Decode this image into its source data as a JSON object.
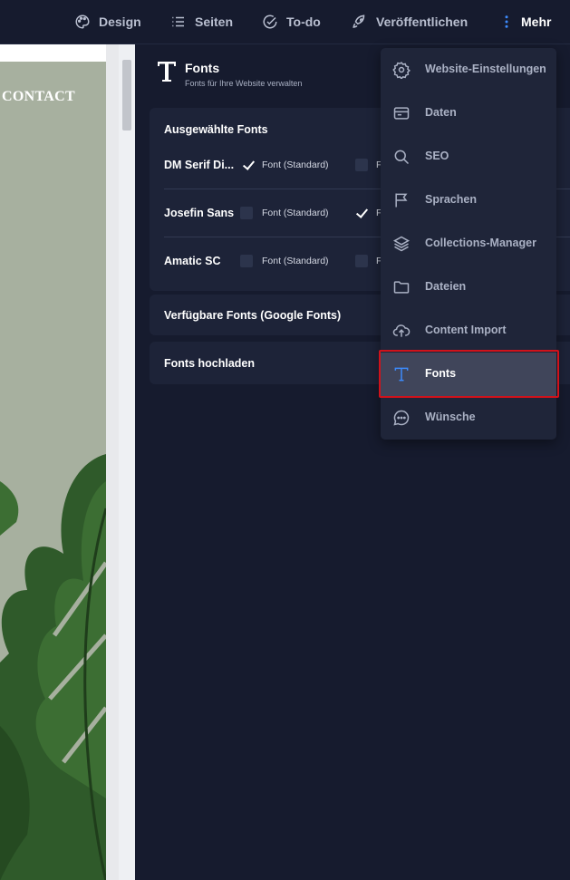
{
  "topbar": {
    "items": [
      {
        "label": "Design",
        "icon": "palette-icon"
      },
      {
        "label": "Seiten",
        "icon": "list-icon"
      },
      {
        "label": "To-do",
        "icon": "check-circle-icon"
      },
      {
        "label": "Veröffentlichen",
        "icon": "rocket-icon"
      },
      {
        "label": "Mehr",
        "icon": "kebab-icon"
      }
    ],
    "accent_color": "#3d8bfd"
  },
  "preview": {
    "nav_text": "CONTACT"
  },
  "panel": {
    "title": "Fonts",
    "subtitle": "Fonts für Ihre Website verwalten",
    "selected_section": {
      "title": "Ausgewählte Fonts",
      "rows": [
        {
          "name": "DM Serif Di...",
          "col1_label": "Font (Standard)",
          "col1_checked": true,
          "col2_label": "F",
          "col2_checked": false
        },
        {
          "name": "Josefin Sans",
          "col1_label": "Font (Standard)",
          "col1_checked": false,
          "col2_label": "F",
          "col2_checked": true
        },
        {
          "name": "Amatic SC",
          "col1_label": "Font (Standard)",
          "col1_checked": false,
          "col2_label": "F",
          "col2_checked": false
        }
      ]
    },
    "available_section": {
      "title": "Verfügbare Fonts (Google Fonts)"
    },
    "upload_section": {
      "title": "Fonts hochladen"
    }
  },
  "menu": {
    "items": [
      {
        "label": "Website-Einstellungen",
        "icon": "gear-icon"
      },
      {
        "label": "Daten",
        "icon": "data-card-icon"
      },
      {
        "label": "SEO",
        "icon": "search-icon"
      },
      {
        "label": "Sprachen",
        "icon": "flag-icon"
      },
      {
        "label": "Collections-Manager",
        "icon": "layers-icon"
      },
      {
        "label": "Dateien",
        "icon": "folder-icon"
      },
      {
        "label": "Content Import",
        "icon": "cloud-upload-icon"
      },
      {
        "label": "Fonts",
        "icon": "font-icon",
        "selected": true
      },
      {
        "label": "Wünsche",
        "icon": "chat-bubble-icon"
      }
    ],
    "highlight_color": "#d0121b"
  }
}
